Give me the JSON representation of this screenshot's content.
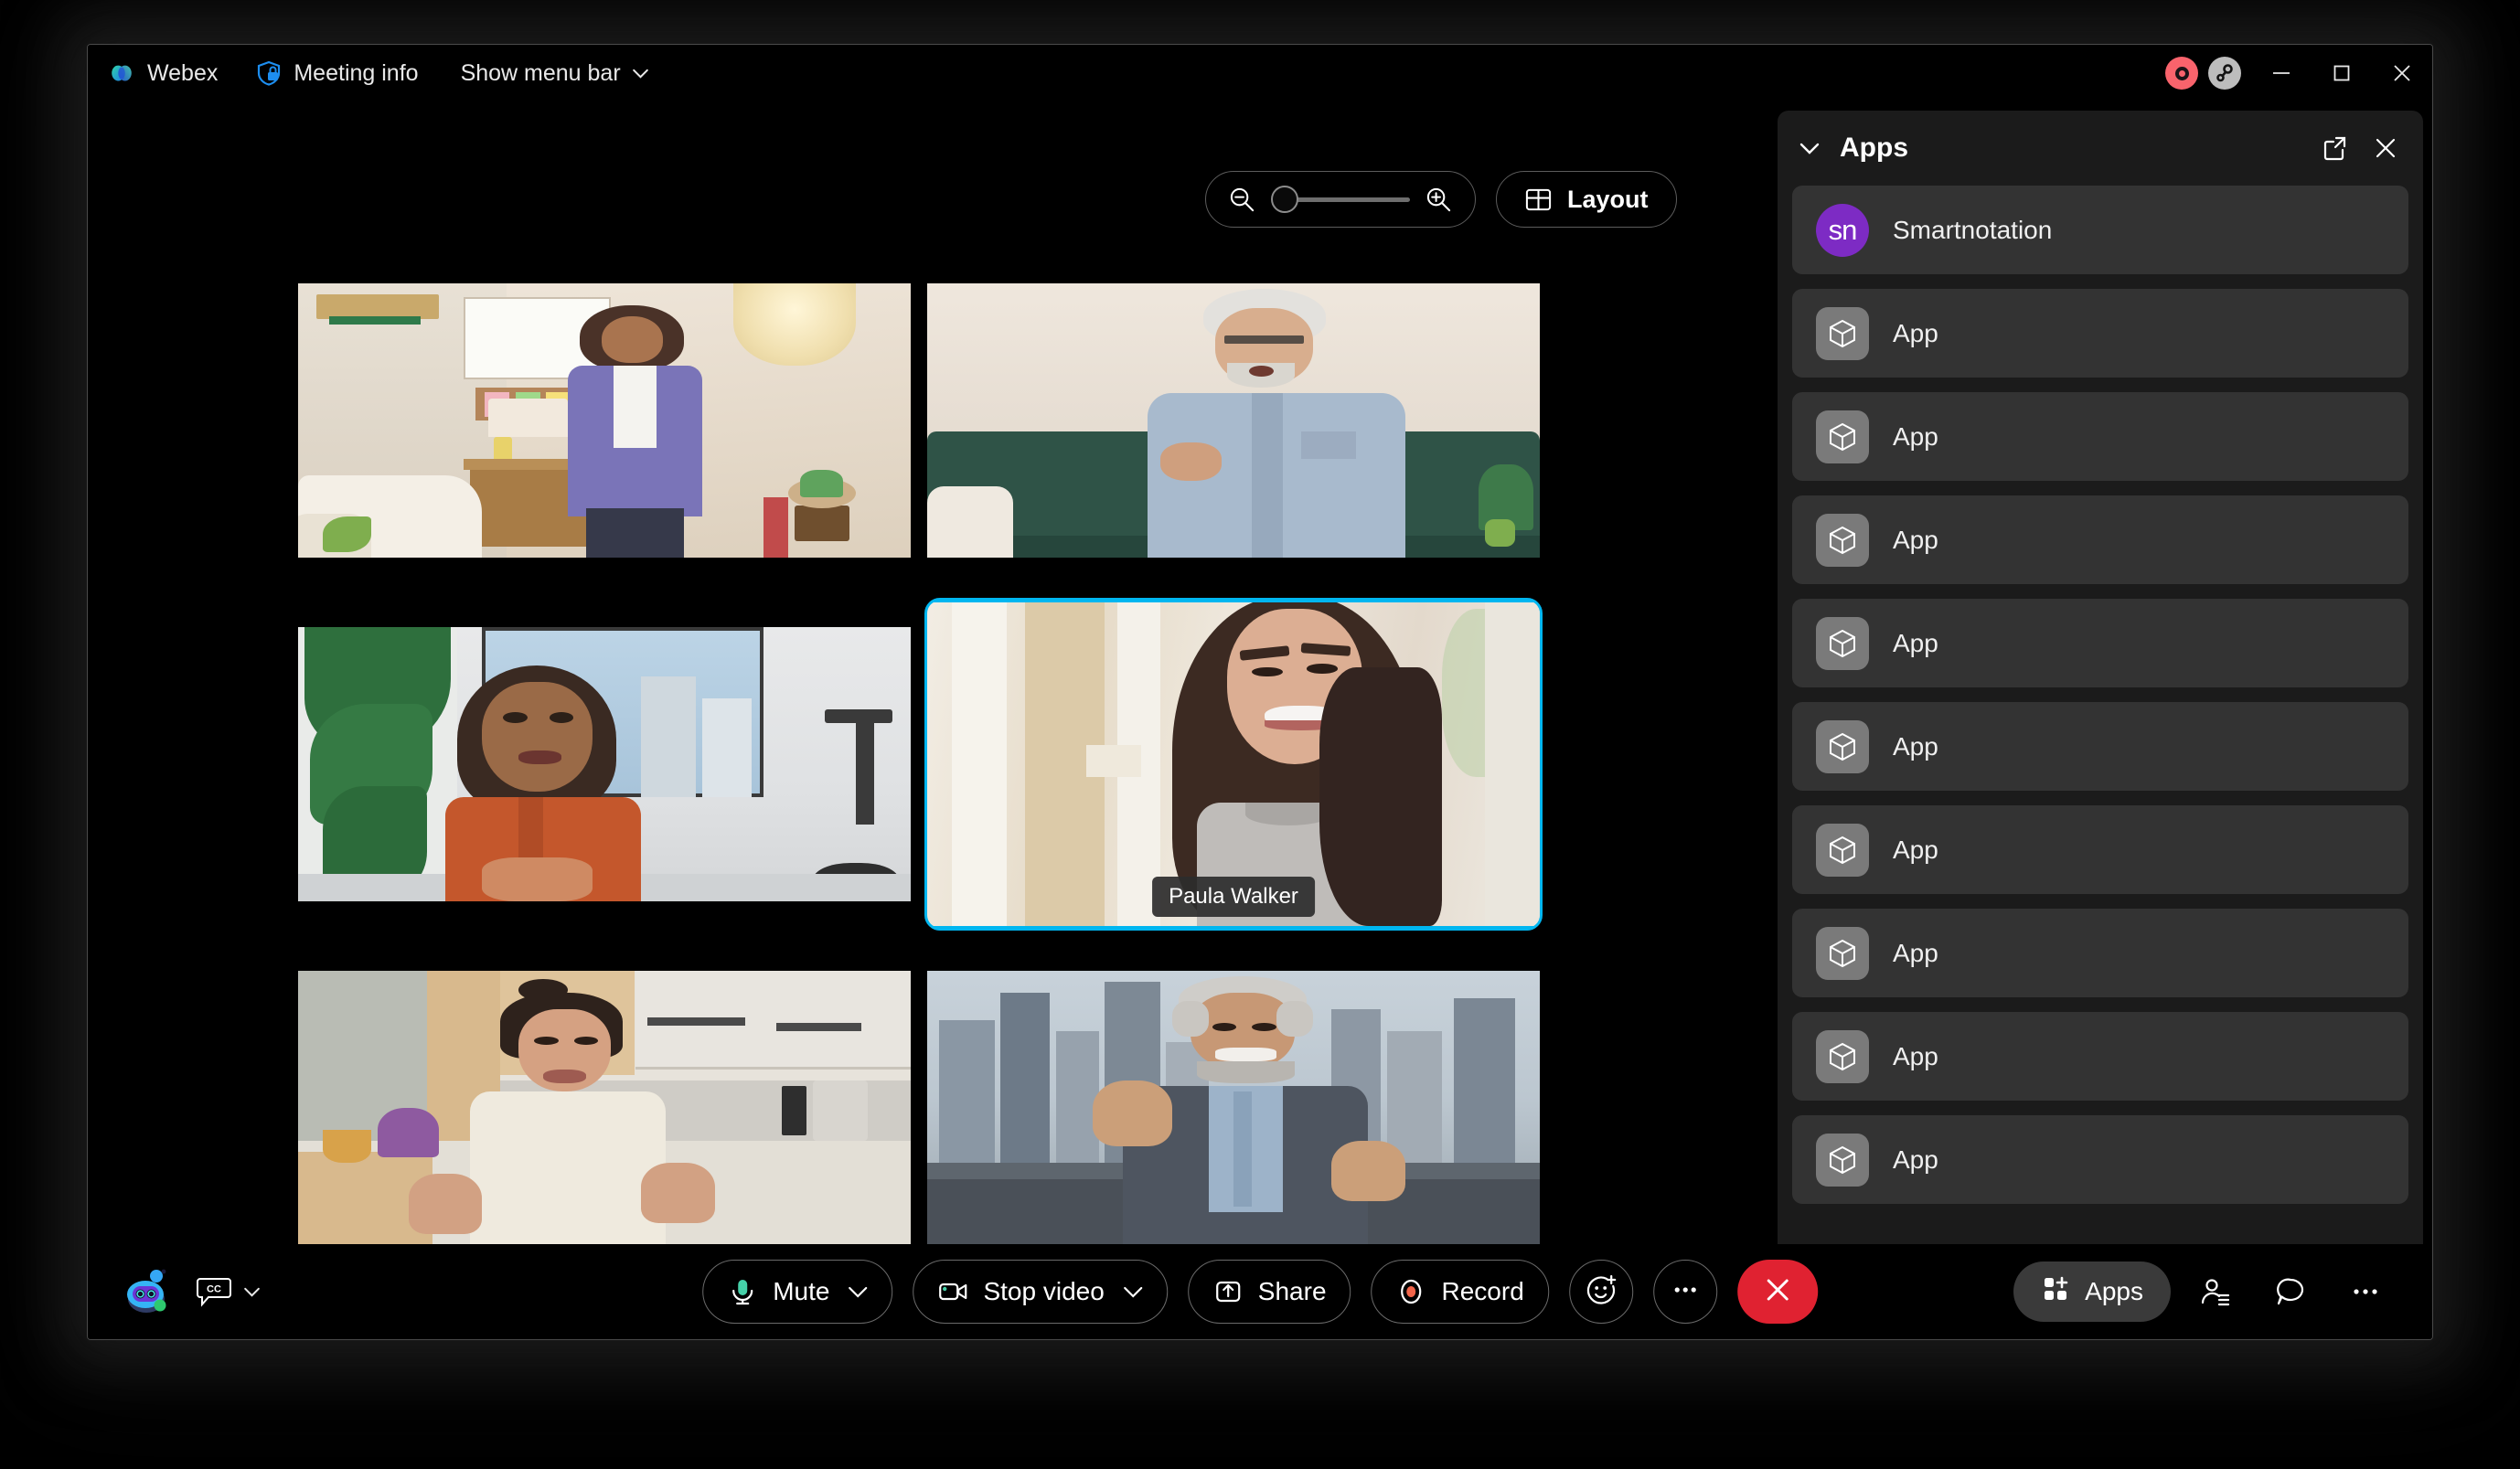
{
  "window": {
    "app_name": "Webex",
    "meeting_info_label": "Meeting info",
    "show_menu_bar_label": "Show menu bar",
    "controls": {
      "minimize": "Minimize",
      "maximize": "Maximize",
      "close": "Close"
    },
    "status": {
      "recording_indicator": "recording-indicator",
      "connection_indicator": "connection-indicator"
    }
  },
  "stage": {
    "zoom": {
      "zoom_out_label": "Zoom out",
      "zoom_in_label": "Zoom in",
      "slider_value": 0
    },
    "layout_label": "Layout"
  },
  "participants": [
    {
      "name": "",
      "name_visible": false,
      "active": false,
      "scene": "bedroom-purple-shirt"
    },
    {
      "name": "",
      "name_visible": false,
      "active": false,
      "scene": "green-sofa-older-man"
    },
    {
      "name": "",
      "name_visible": false,
      "active": false,
      "scene": "office-plant-curly-hair"
    },
    {
      "name": "Paula Walker",
      "name_visible": true,
      "active": true,
      "scene": "hallway-long-hair"
    },
    {
      "name": "",
      "name_visible": false,
      "active": false,
      "scene": "kitchen-cream-blouse"
    },
    {
      "name": "",
      "name_visible": false,
      "active": false,
      "scene": "city-skyline-headphones"
    }
  ],
  "apps_panel": {
    "title": "Apps",
    "collapse_label": "Collapse",
    "popout_label": "Open in new window",
    "close_label": "Close panel",
    "items": [
      {
        "label": "Smartnotation",
        "icon": "sn-avatar",
        "initials": "sn",
        "accent": "#7d2bc4"
      },
      {
        "label": "App",
        "icon": "box-icon"
      },
      {
        "label": "App",
        "icon": "box-icon"
      },
      {
        "label": "App",
        "icon": "box-icon"
      },
      {
        "label": "App",
        "icon": "box-icon"
      },
      {
        "label": "App",
        "icon": "box-icon"
      },
      {
        "label": "App",
        "icon": "box-icon"
      },
      {
        "label": "App",
        "icon": "box-icon"
      },
      {
        "label": "App",
        "icon": "box-icon"
      },
      {
        "label": "App",
        "icon": "box-icon"
      }
    ]
  },
  "control_bar": {
    "assistant_label": "AI assistant",
    "captions_label": "Closed captions",
    "mute_label": "Mute",
    "stop_video_label": "Stop video",
    "share_label": "Share",
    "record_label": "Record",
    "reactions_label": "Reactions",
    "more_options_label": "More options",
    "leave_label": "Leave meeting",
    "apps_label": "Apps",
    "participants_label": "Participants",
    "chat_label": "Chat",
    "more_label": "More"
  },
  "colors": {
    "accent_active_speaker": "#00b6f0",
    "leave_red": "#e02231",
    "record_red": "#f2654a",
    "mic_green": "#45d0a8",
    "panel_bg": "#1b1b1b",
    "row_bg": "#333333"
  }
}
